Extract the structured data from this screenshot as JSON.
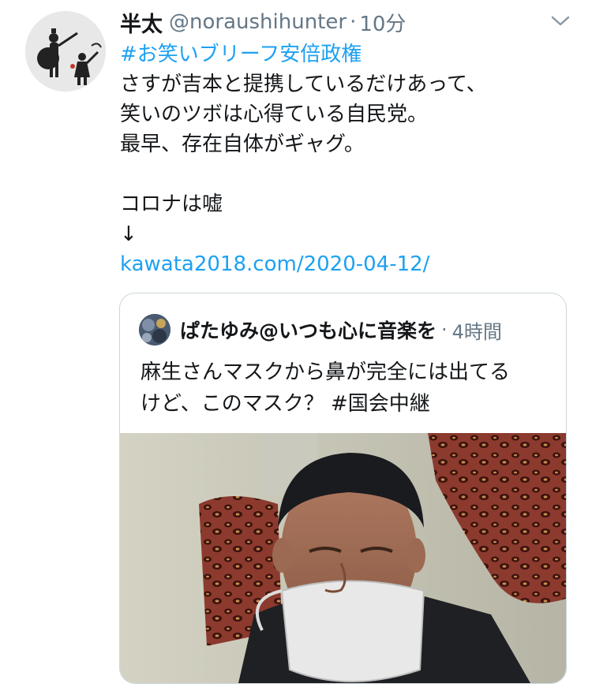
{
  "tweet": {
    "author_name": "半太",
    "handle": "@noraushihunter",
    "separator": "·",
    "time": "10分",
    "hashtag": "#お笑いブリーフ安倍政権",
    "lines": [
      "さすが吉本と提携しているだけあって、",
      "笑いのツボは心得ている自民党。",
      "最早、存在自体がギャグ。",
      "",
      "コロナは嘘",
      "↓"
    ],
    "link": "kawata2018.com/2020-04-12/"
  },
  "quoted_tweet": {
    "author_name": "ぱたゆみ@いつも心に音楽を",
    "separator": "·",
    "time": "4時間",
    "lines": [
      "麻生さんマスクから鼻が完全には出てる",
      "けど、このマスク？ #国会中継"
    ]
  },
  "icons": {
    "avatar": "silhouette-figures-avatar",
    "caret": "chevron-down-icon",
    "quoted_avatar": "profile-photo-avatar",
    "photo": "attached-photo"
  },
  "colors": {
    "link": "#1da1f2",
    "secondary_text": "#657786",
    "border": "#ccd6dd"
  }
}
